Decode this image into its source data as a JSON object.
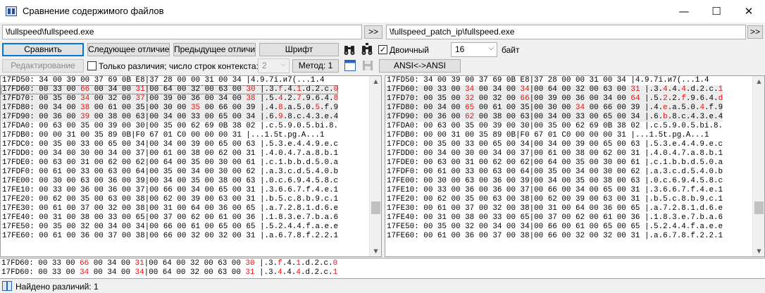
{
  "window": {
    "title": "Сравнение содержимого файлов",
    "minimize": "—",
    "maximize": "☐",
    "close": "✕"
  },
  "files": {
    "left_path": "\\fullspeed\\fullspeed.exe",
    "right_path": "\\fullspeed_patch_ip\\fullspeed.exe",
    "browse_label": ">>"
  },
  "toolbar": {
    "compare": "Сравнить",
    "next_diff": "Следующее отличие",
    "prev_diff": "Предыдущее отличие",
    "font": "Шрифт",
    "binary_label": "Двоичный",
    "binary_checked": true,
    "width_value": "16",
    "width_unit": "байт",
    "edit": "Редактирование",
    "only_diffs_label": "Только различия; число строк контекста:",
    "only_diffs_checked": false,
    "context_value": "2",
    "method": "Метод: 1",
    "ansi": "ANSI<->ANSI"
  },
  "left_rows": [
    [
      {
        "t": "17FD50: 34 00 39 00 37 69 0B E8|37 28 00 00 31 00 34 |4.9.7i.и7(...1.4"
      }
    ],
    [
      {
        "t": "17FD60: 00 33 00 "
      },
      {
        "t": "66",
        "d": true
      },
      {
        "t": " 00 34 00 "
      },
      {
        "t": "31",
        "d": true
      },
      {
        "t": "|00 64 00 32 00 63 00 "
      },
      {
        "t": "30",
        "d": true
      },
      {
        "t": " |.3."
      },
      {
        "t": "f",
        "d": true
      },
      {
        "t": ".4."
      },
      {
        "t": "1",
        "d": true
      },
      {
        "t": ".d.2.c."
      },
      {
        "t": "0",
        "d": true
      }
    ],
    [
      {
        "t": "17FD70: 00 35 00 "
      },
      {
        "t": "34",
        "d": true
      },
      {
        "t": " 00 32 00 "
      },
      {
        "t": "37",
        "d": true
      },
      {
        "t": "|00 39 00 36 00 34 00 "
      },
      {
        "t": "38",
        "d": true
      },
      {
        "t": " |.5."
      },
      {
        "t": "4",
        "d": true
      },
      {
        "t": ".2."
      },
      {
        "t": "7",
        "d": true
      },
      {
        "t": ".9.6.4."
      },
      {
        "t": "8",
        "d": true
      }
    ],
    [
      {
        "t": "17FD80: 00 34 00 "
      },
      {
        "t": "38",
        "d": true
      },
      {
        "t": " 00 61 00 35|00 30 00 "
      },
      {
        "t": "35",
        "d": true
      },
      {
        "t": " 00 66 00 39 |.4."
      },
      {
        "t": "8",
        "d": true
      },
      {
        "t": ".a.5.0."
      },
      {
        "t": "5",
        "d": true
      },
      {
        "t": ".f.9"
      }
    ],
    [
      {
        "t": "17FD90: 00 36 00 "
      },
      {
        "t": "39",
        "d": true
      },
      {
        "t": " 00 38 00 63|00 34 00 33 00 65 00 34 |.6."
      },
      {
        "t": "9",
        "d": true
      },
      {
        "t": ".8.c.4.3.e.4"
      }
    ],
    [
      {
        "t": "17FDA0: 00 63 00 35 00 39 00 30|00 35 00 62 69 0B 38 02 |.c.5.9.0.5.bi.8."
      }
    ],
    [
      {
        "t": "17FDB0: 00 00 31 00 35 89 0B|F0 67 01 C0 00 00 00 31 |...1.5t.pg.A...1"
      }
    ],
    [
      {
        "t": "17FDC0: 00 35 00 33 00 65 00 34|00 34 00 39 00 65 00 63 |.5.3.e.4.4.9.e.c"
      }
    ],
    [
      {
        "t": "17FDD0: 00 34 00 30 00 34 00 37|00 61 00 38 00 62 00 31 |.4.0.4.7.a.8.b.1"
      }
    ],
    [
      {
        "t": "17FDE0: 00 63 00 31 00 62 00 62|00 64 00 35 00 30 00 61 |.c.1.b.b.d.5.0.a"
      }
    ],
    [
      {
        "t": "17FDF0: 00 61 00 33 00 63 00 64|00 35 00 34 00 30 00 62 |.a.3.c.d.5.4.0.b"
      }
    ],
    [
      {
        "t": "17FE00: 00 30 00 63 00 36 00 39|00 34 00 35 00 38 00 63 |.0.c.6.9.4.5.8.c"
      }
    ],
    [
      {
        "t": "17FE10: 00 33 00 36 00 36 00 37|00 66 00 34 00 65 00 31 |.3.6.6.7.f.4.e.1"
      }
    ],
    [
      {
        "t": "17FE20: 00 62 00 35 00 63 00 38|00 62 00 39 00 63 00 31 |.b.5.c.8.b.9.c.1"
      }
    ],
    [
      {
        "t": "17FE30: 00 61 00 37 00 32 00 38|00 31 00 64 00 36 00 65 |.a.7.2.8.1.d.6.e"
      }
    ],
    [
      {
        "t": "17FE40: 00 31 00 38 00 33 00 65|00 37 00 62 00 61 00 36 |.1.8.3.e.7.b.a.6"
      }
    ],
    [
      {
        "t": "17FE50: 00 35 00 32 00 34 00 34|00 66 00 61 00 65 00 65 |.5.2.4.4.f.a.e.e"
      }
    ],
    [
      {
        "t": "17FE60: 00 61 00 36 00 37 00 38|00 66 00 32 00 32 00 31 |.a.6.7.8.f.2.2.1"
      }
    ]
  ],
  "right_rows": [
    [
      {
        "t": "17FD50: 34 00 39 00 37 69 0B E8|37 28 00 00 31 00 34 |4.9.7i.и7(...1.4"
      }
    ],
    [
      {
        "t": "17FD60: 00 33 00 "
      },
      {
        "t": "34",
        "d": true
      },
      {
        "t": " 00 34 00 "
      },
      {
        "t": "34",
        "d": true
      },
      {
        "t": "|00 64 00 32 00 63 00 "
      },
      {
        "t": "31",
        "d": true
      },
      {
        "t": " |.3."
      },
      {
        "t": "4",
        "d": true
      },
      {
        "t": ".4."
      },
      {
        "t": "4",
        "d": true
      },
      {
        "t": ".d.2.c."
      },
      {
        "t": "1",
        "d": true
      }
    ],
    [
      {
        "t": "17FD70: 00 35 00 "
      },
      {
        "t": "32",
        "d": true
      },
      {
        "t": " 00 32 00 "
      },
      {
        "t": "66",
        "d": true
      },
      {
        "t": "|00 39 00 36 00 34 00 "
      },
      {
        "t": "64",
        "d": true
      },
      {
        "t": " |.5."
      },
      {
        "t": "2",
        "d": true
      },
      {
        "t": ".2."
      },
      {
        "t": "f",
        "d": true
      },
      {
        "t": ".9.6.4."
      },
      {
        "t": "d",
        "d": true
      }
    ],
    [
      {
        "t": "17FD80: 00 34 00 "
      },
      {
        "t": "65",
        "d": true
      },
      {
        "t": " 00 61 00 35|00 30 00 "
      },
      {
        "t": "34",
        "d": true
      },
      {
        "t": " 00 66 00 39 |.4."
      },
      {
        "t": "e",
        "d": true
      },
      {
        "t": ".a.5.0."
      },
      {
        "t": "4",
        "d": true
      },
      {
        "t": ".f.9"
      }
    ],
    [
      {
        "t": "17FD90: 00 36 00 "
      },
      {
        "t": "62",
        "d": true
      },
      {
        "t": " 00 38 00 63|00 34 00 33 00 65 00 34 |.6."
      },
      {
        "t": "b",
        "d": true
      },
      {
        "t": ".8.c.4.3.e.4"
      }
    ],
    [
      {
        "t": "17FDA0: 00 63 00 35 00 39 00 30|00 35 00 62 69 0B 38 02 |.c.5.9.0.5.bi.8."
      }
    ],
    [
      {
        "t": "17FDB0: 00 00 31 00 35 89 0B|F0 67 01 C0 00 00 00 31 |...1.5t.pg.A...1"
      }
    ],
    [
      {
        "t": "17FDC0: 00 35 00 33 00 65 00 34|00 34 00 39 00 65 00 63 |.5.3.e.4.4.9.e.c"
      }
    ],
    [
      {
        "t": "17FDD0: 00 34 00 30 00 34 00 37|00 61 00 38 00 62 00 31 |.4.0.4.7.a.8.b.1"
      }
    ],
    [
      {
        "t": "17FDE0: 00 63 00 31 00 62 00 62|00 64 00 35 00 30 00 61 |.c.1.b.b.d.5.0.a"
      }
    ],
    [
      {
        "t": "17FDF0: 00 61 00 33 00 63 00 64|00 35 00 34 00 30 00 62 |.a.3.c.d.5.4.0.b"
      }
    ],
    [
      {
        "t": "17FE00: 00 30 00 63 00 36 00 39|00 34 00 35 00 38 00 63 |.0.c.6.9.4.5.8.c"
      }
    ],
    [
      {
        "t": "17FE10: 00 33 00 36 00 36 00 37|00 66 00 34 00 65 00 31 |.3.6.6.7.f.4.e.1"
      }
    ],
    [
      {
        "t": "17FE20: 00 62 00 35 00 63 00 38|00 62 00 39 00 63 00 31 |.b.5.c.8.b.9.c.1"
      }
    ],
    [
      {
        "t": "17FE30: 00 61 00 37 00 32 00 38|00 31 00 64 00 36 00 65 |.a.7.2.8.1.d.6.e"
      }
    ],
    [
      {
        "t": "17FE40: 00 31 00 38 00 33 00 65|00 37 00 62 00 61 00 36 |.1.8.3.e.7.b.a.6"
      }
    ],
    [
      {
        "t": "17FE50: 00 35 00 32 00 34 00 34|00 66 00 61 00 65 00 65 |.5.2.4.4.f.a.e.e"
      }
    ],
    [
      {
        "t": "17FE60: 00 61 00 36 00 37 00 38|00 66 00 32 00 32 00 31 |.a.6.7.8.f.2.2.1"
      }
    ]
  ],
  "bottom_rows": [
    [
      {
        "t": "17FD60: 00 33 00 "
      },
      {
        "t": "66",
        "d": true
      },
      {
        "t": " 00 34 00 "
      },
      {
        "t": "31",
        "d": true
      },
      {
        "t": "|00 64 00 32 00 63 00 "
      },
      {
        "t": "30",
        "d": true
      },
      {
        "t": " |.3."
      },
      {
        "t": "f",
        "d": true
      },
      {
        "t": ".4."
      },
      {
        "t": "1",
        "d": true
      },
      {
        "t": ".d.2.c."
      },
      {
        "t": "0",
        "d": true
      }
    ],
    [
      {
        "t": "17FD60: 00 33 00 "
      },
      {
        "t": "34",
        "d": true
      },
      {
        "t": " 00 34 00 "
      },
      {
        "t": "34",
        "d": true
      },
      {
        "t": "|00 64 00 32 00 63 00 "
      },
      {
        "t": "31",
        "d": true
      },
      {
        "t": " |.3."
      },
      {
        "t": "4",
        "d": true
      },
      {
        "t": ".4."
      },
      {
        "t": "4",
        "d": true
      },
      {
        "t": ".d.2.c."
      },
      {
        "t": "1",
        "d": true
      }
    ]
  ],
  "status": {
    "text": "Найдено различий: 1"
  },
  "colors": {
    "diff": "#e81010",
    "highlight_row": "#ececec",
    "accent": "#0078d7"
  }
}
